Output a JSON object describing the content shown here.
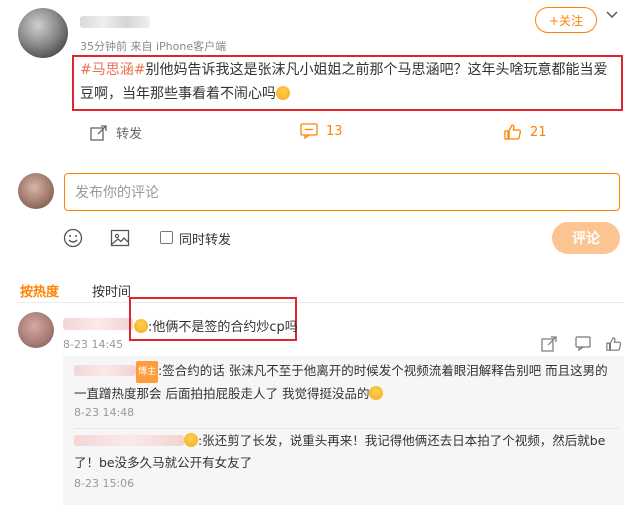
{
  "post": {
    "time_source": "35分钟前 来自 iPhone客户端",
    "follow_label": "+关注",
    "hashtag": "#马思涵#",
    "text": "别他妈告诉我这是张沫凡小姐姐之前那个马思涵吧？这年头啥玩意都能当爱豆啊，当年那些事看着不闹心吗",
    "repost_label": "转发",
    "comment_count": "13",
    "like_count": "21"
  },
  "compose": {
    "placeholder": "发布你的评论",
    "also_repost_label": "同时转发",
    "submit_label": "评论"
  },
  "sort_tabs": {
    "hot": "按热度",
    "time": "按时间"
  },
  "comment": {
    "text": ":他俩不是签的合约炒cp吗",
    "time": "8-23 14:45"
  },
  "replies": [
    {
      "badge": "博主",
      "text": ":签合约的话 张沫凡不至于他离开的时候发个视频流着眼泪解释告别吧 而且这男的一直蹭热度那会 后面拍拍屁股走人了 我觉得挺没品的",
      "time": "8-23 14:48"
    },
    {
      "text": ":张还剪了长发，说重头再来！我记得他俩还去日本拍了个视频，然后就be了！be没多久马就公开有女友了",
      "time": "8-23 15:06"
    }
  ],
  "colors": {
    "accent": "#ff8200",
    "hashtag": "#eb7350",
    "highlight_box": "#e0252f"
  }
}
